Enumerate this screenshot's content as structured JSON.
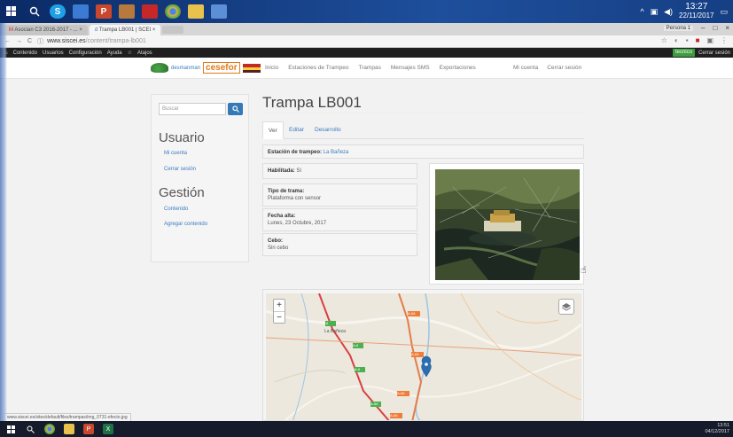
{
  "os": {
    "clock_time": "13:27",
    "clock_date": "22/11/2017",
    "bottom_time": "13:51",
    "bottom_date": "04/12/2017"
  },
  "browser": {
    "tabs": [
      {
        "label": "Asocian C3 2016-2017 - ..."
      },
      {
        "label": "Trampa LB001 | SCEI"
      }
    ],
    "url_host": "www.siscei.es",
    "url_path": "/content/trampa-lb001",
    "profile": "Persona 1"
  },
  "admin_toolbar": {
    "items": [
      "Contenido",
      "Usuarios",
      "Configuración",
      "Ayuda",
      "Atajos"
    ],
    "role": "tecnico",
    "logout": "Cerrar sesión"
  },
  "header": {
    "logo_text": "desmanman",
    "logo_cese": "cesefor",
    "nav": [
      "Inicio",
      "Estaciones de Trampeo",
      "Trampas",
      "Mensajes SMS",
      "Exportaciones"
    ],
    "user_nav": [
      "Mi cuenta",
      "Cerrar sesión"
    ]
  },
  "sidebar": {
    "search_placeholder": "Buscar",
    "section_user": "Usuario",
    "user_links": [
      "Mi cuenta",
      "Cerrar sesión"
    ],
    "section_management": "Gestión",
    "management_links": [
      "Contenido",
      "Agregar contenido"
    ]
  },
  "content": {
    "title": "Trampa LB001",
    "tabs": [
      "Ver",
      "Editar",
      "Desarrollo"
    ],
    "station_label": "Estación de trampeo:",
    "station_value": "La Bañeza",
    "enabled_label": "Habilitada:",
    "enabled_value": "Sí",
    "trap_type_label": "Tipo de trama:",
    "trap_type_value": "Plataforma con sensor",
    "date_label": "Fecha alta:",
    "date_value": "Lunes, 23 Octubre, 2017",
    "bait_label": "Cebo:",
    "bait_value": "Sin cebo"
  },
  "map": {
    "zoom_in": "+",
    "zoom_out": "−",
    "town": "La Bañeza",
    "roads": [
      "A-6",
      "A-66",
      "A-66",
      "A-6",
      "A-66",
      "A-66",
      "A-6",
      "A-66"
    ]
  },
  "status_bar": "www.siscei.es/sites/default/files/trampas/img_0731-efecto.jpg",
  "colors": {
    "link": "#3a7bbf",
    "primary_button": "#337ab7",
    "admin_bar": "#1f1f1f",
    "role_badge": "#3c9d3c"
  }
}
